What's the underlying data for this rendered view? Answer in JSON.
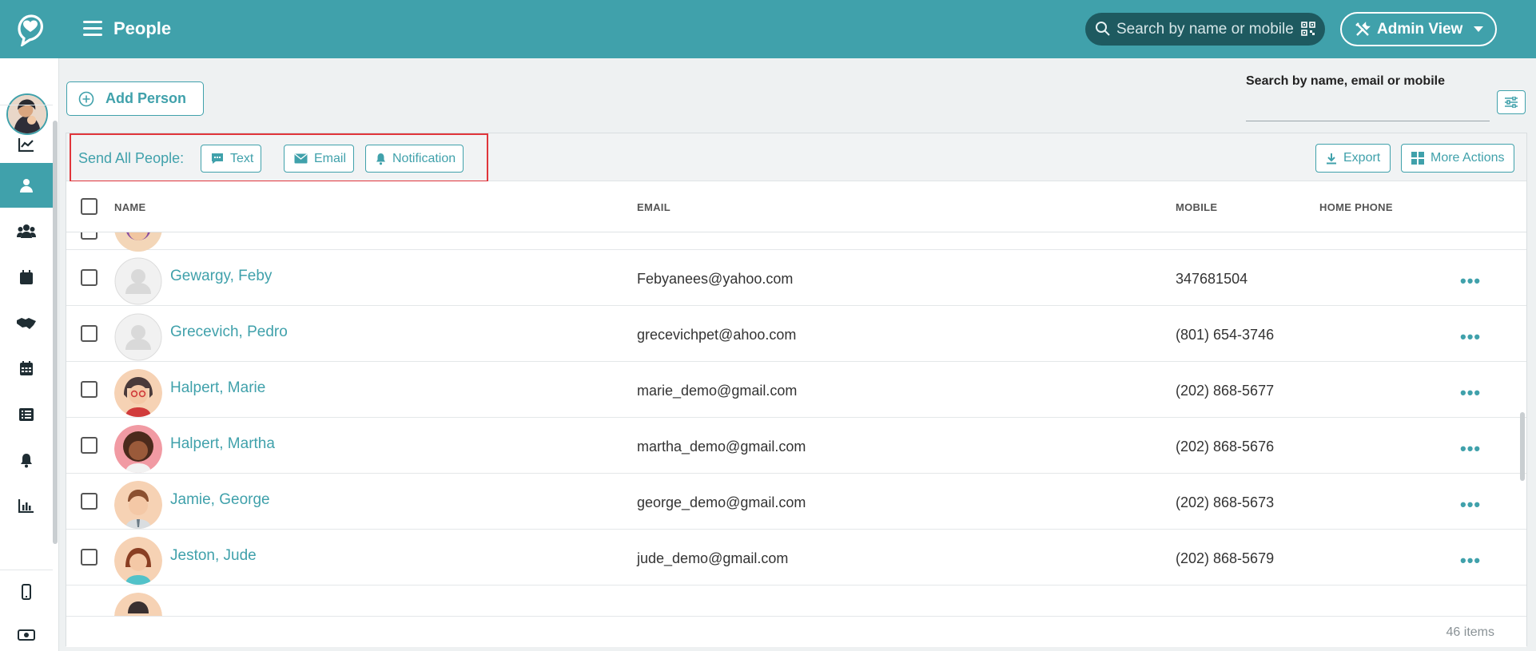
{
  "header": {
    "title": "People",
    "search_placeholder": "Search by name or mobile",
    "admin_view_label": "Admin View"
  },
  "toolbar": {
    "add_person_label": "Add Person",
    "search_label": "Search by name, email or mobile",
    "search_value": ""
  },
  "send_bar": {
    "label": "Send All People:",
    "text_label": "Text",
    "email_label": "Email",
    "notification_label": "Notification",
    "export_label": "Export",
    "more_actions_label": "More Actions"
  },
  "table": {
    "columns": [
      "NAME",
      "EMAIL",
      "MOBILE",
      "HOME PHONE"
    ],
    "rows": [
      {
        "name": "Gewargy, Feby",
        "email": "Febyanees@yahoo.com",
        "mobile": "347681504",
        "home_phone": "",
        "avatar": "placeholder"
      },
      {
        "name": "Grecevich, Pedro",
        "email": "grecevichpet@ahoo.com",
        "mobile": "(801) 654-3746",
        "home_phone": "",
        "avatar": "placeholder"
      },
      {
        "name": "Halpert, Marie",
        "email": "marie_demo@gmail.com",
        "mobile": "(202) 868-5677",
        "home_phone": "",
        "avatar": "girl-glasses"
      },
      {
        "name": "Halpert, Martha",
        "email": "martha_demo@gmail.com",
        "mobile": "(202) 868-5676",
        "home_phone": "",
        "avatar": "woman-curly"
      },
      {
        "name": "Jamie, George",
        "email": "george_demo@gmail.com",
        "mobile": "(202) 868-5673",
        "home_phone": "",
        "avatar": "man-tie"
      },
      {
        "name": "Jeston, Jude",
        "email": "jude_demo@gmail.com",
        "mobile": "(202) 868-5679",
        "home_phone": "",
        "avatar": "girl-red-hair"
      }
    ],
    "more_glyph": "•••",
    "item_count": "46 items"
  },
  "sidebar": {
    "items": [
      "chart-line-icon",
      "person-icon",
      "users-icon",
      "calendar-icon",
      "handshake-icon",
      "calendar-grid-icon",
      "list-icon",
      "bell-icon",
      "bar-chart-icon",
      "mobile-icon",
      "money-icon"
    ],
    "active": "person-icon"
  },
  "colors": {
    "brand": "#40a1ab",
    "highlight": "#e0353b"
  }
}
